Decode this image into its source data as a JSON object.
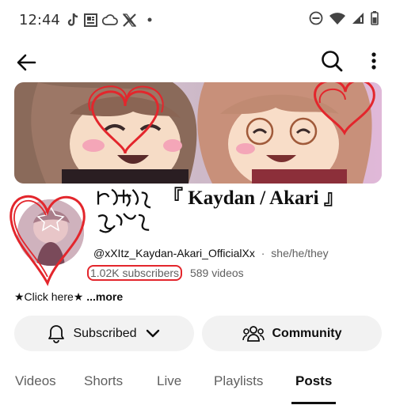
{
  "status_bar": {
    "time": "12:44",
    "left_icons": [
      "tiktok-icon",
      "news-icon",
      "cloud-icon",
      "x-logo-icon",
      "dot-icon"
    ],
    "right_icons": [
      "do-not-disturb-icon",
      "wifi-icon",
      "signal-icon",
      "battery-icon"
    ]
  },
  "app_bar": {
    "back_icon": "arrow-left-icon",
    "search_icon": "search-icon",
    "more_icon": "more-vert-icon"
  },
  "channel": {
    "name": "『 Kaydan / Akari 』",
    "handle": "@xXItz_Kaydan-Akari_OfficialXx",
    "separator": "·",
    "pronouns": "she/he/they",
    "subscribers": "1.02K subscribers",
    "videos": "589 videos",
    "description": "★Click here★",
    "more": "...more"
  },
  "buttons": {
    "subscribed": "Subscribed",
    "community": "Community"
  },
  "tabs": [
    {
      "label": "Videos",
      "active": false
    },
    {
      "label": "Shorts",
      "active": false
    },
    {
      "label": "Live",
      "active": false
    },
    {
      "label": "Playlists",
      "active": false
    },
    {
      "label": "Posts",
      "active": true
    }
  ],
  "colors": {
    "text_primary": "#0f0f0f",
    "text_secondary": "#606060",
    "button_bg": "#f2f2f2",
    "highlight_red": "#e3262c"
  }
}
